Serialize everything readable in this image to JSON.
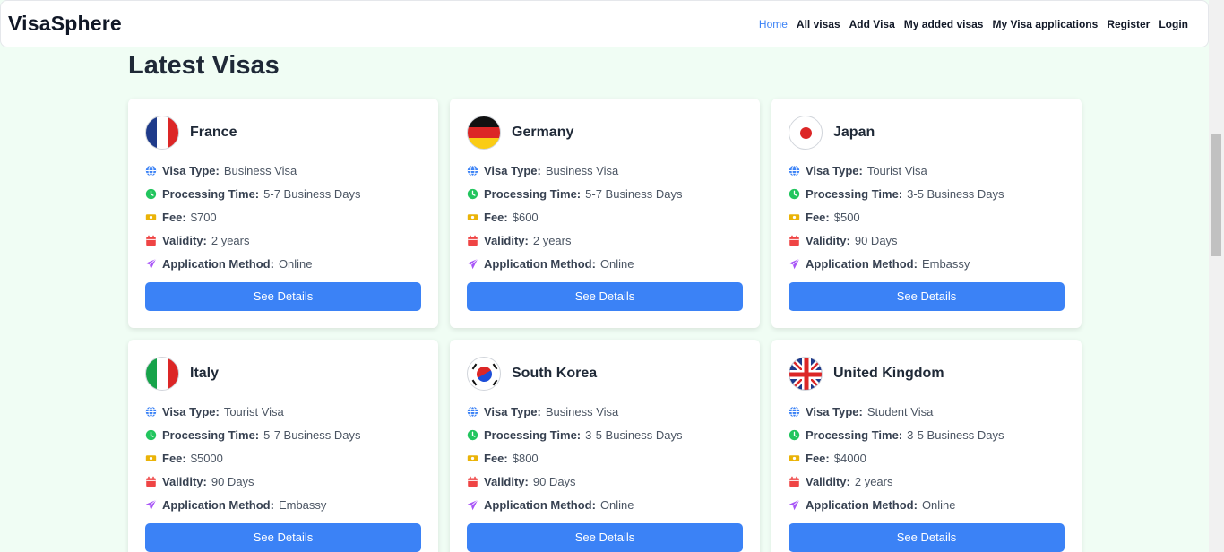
{
  "brand": "VisaSphere",
  "nav": [
    "Home",
    "All visas",
    "Add Visa",
    "My added visas",
    "My Visa applications",
    "Register",
    "Login"
  ],
  "heading": "Latest Visas",
  "labels": {
    "visa_type": "Visa Type:",
    "processing": "Processing Time:",
    "fee": "Fee:",
    "validity": "Validity:",
    "method": "Application Method:",
    "button": "See Details"
  },
  "icons": {
    "visa_type": "globe-icon",
    "processing": "clock-icon",
    "fee": "ticket-icon",
    "validity": "calendar-icon",
    "method": "paper-plane-icon"
  },
  "colors": {
    "accent": "#3b82f6",
    "background": "#f0fdf4"
  },
  "visas": [
    {
      "country": "France",
      "flag": "france-flag-icon",
      "visa_type": "Business Visa",
      "processing": "5-7 Business Days",
      "fee": "$700",
      "validity": "2 years",
      "method": "Online"
    },
    {
      "country": "Germany",
      "flag": "germany-flag-icon",
      "visa_type": "Business Visa",
      "processing": "5-7 Business Days",
      "fee": "$600",
      "validity": "2 years",
      "method": "Online"
    },
    {
      "country": "Japan",
      "flag": "japan-flag-icon",
      "visa_type": "Tourist Visa",
      "processing": "3-5 Business Days",
      "fee": "$500",
      "validity": "90 Days",
      "method": "Embassy"
    },
    {
      "country": "Italy",
      "flag": "italy-flag-icon",
      "visa_type": "Tourist Visa",
      "processing": "5-7 Business Days",
      "fee": "$5000",
      "validity": "90 Days",
      "method": "Embassy"
    },
    {
      "country": "South Korea",
      "flag": "south-korea-flag-icon",
      "visa_type": "Business Visa",
      "processing": "3-5 Business Days",
      "fee": "$800",
      "validity": "90 Days",
      "method": "Online"
    },
    {
      "country": "United Kingdom",
      "flag": "uk-flag-icon",
      "visa_type": "Student Visa",
      "processing": "3-5 Business Days",
      "fee": "$4000",
      "validity": "2 years",
      "method": "Online"
    }
  ]
}
